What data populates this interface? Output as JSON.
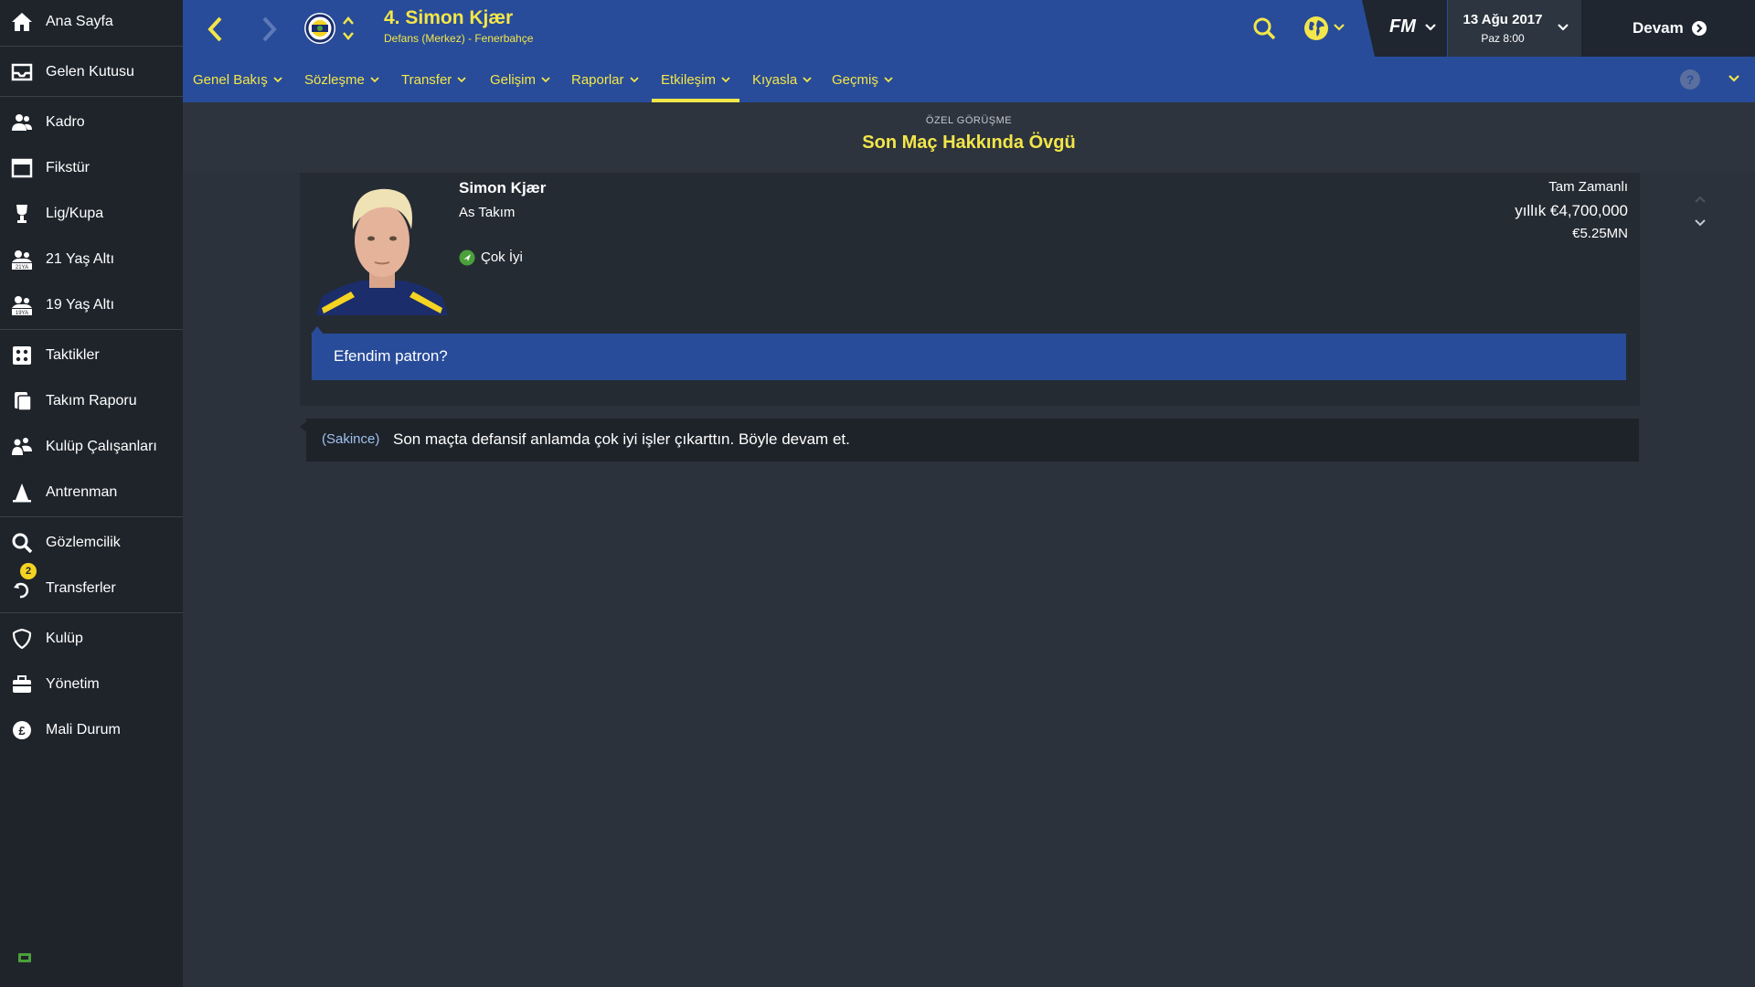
{
  "sidebar": {
    "items": [
      {
        "label": "Ana Sayfa",
        "icon": "home-icon"
      },
      {
        "label": "Gelen Kutusu",
        "icon": "inbox-icon"
      },
      {
        "label": "Kadro",
        "icon": "squad-icon"
      },
      {
        "label": "Fikstür",
        "icon": "calendar-icon"
      },
      {
        "label": "Lig/Kupa",
        "icon": "trophy-icon"
      },
      {
        "label": "21 Yaş Altı",
        "icon": "u21-icon"
      },
      {
        "label": "19 Yaş Altı",
        "icon": "u19-icon"
      },
      {
        "label": "Taktikler",
        "icon": "tactics-icon"
      },
      {
        "label": "Takım Raporu",
        "icon": "report-icon"
      },
      {
        "label": "Kulüp Çalışanları",
        "icon": "staff-icon"
      },
      {
        "label": "Antrenman",
        "icon": "training-cone-icon"
      },
      {
        "label": "Gözlemcilik",
        "icon": "search-icon"
      },
      {
        "label": "Transferler",
        "icon": "transfer-icon",
        "badge": "2"
      },
      {
        "label": "Kulüp",
        "icon": "club-shield-icon"
      },
      {
        "label": "Yönetim",
        "icon": "briefcase-icon"
      },
      {
        "label": "Mali Durum",
        "icon": "pound-coin-icon"
      }
    ]
  },
  "header": {
    "player_title": "4. Simon Kjær",
    "player_subtitle": "Defans (Merkez) - Fenerbahçe",
    "fm_logo": "FM",
    "date": "13 Ağu 2017",
    "time": "Paz 8:00",
    "continue_label": "Devam"
  },
  "tabs": [
    {
      "label": "Genel Bakış"
    },
    {
      "label": "Sözleşme"
    },
    {
      "label": "Transfer"
    },
    {
      "label": "Gelişim"
    },
    {
      "label": "Raporlar"
    },
    {
      "label": "Etkileşim",
      "active": true
    },
    {
      "label": "Kıyasla"
    },
    {
      "label": "Geçmiş"
    }
  ],
  "conversation": {
    "kicker": "ÖZEL GÖRÜŞME",
    "title": "Son Maç Hakkında Övgü",
    "player_name": "Simon Kjær",
    "squad_status": "As Takım",
    "morale": "Çok İyi",
    "contract_type": "Tam Zamanlı",
    "wage": "yıllık €4,700,000",
    "value": "€5.25MN",
    "player_reply": "Efendim patron?",
    "response_tone": "(Sakince)",
    "response_text": "Son maçta defansif anlamda çok iyi işler çıkarttın. Böyle devam et."
  },
  "colors": {
    "header_bg": "#284c99",
    "accent_yellow": "#f3e64a",
    "sidebar_bg": "#1f242b",
    "content_bg": "#2b323b",
    "card_bg": "#252b33",
    "morale_green": "#4aa03a"
  }
}
